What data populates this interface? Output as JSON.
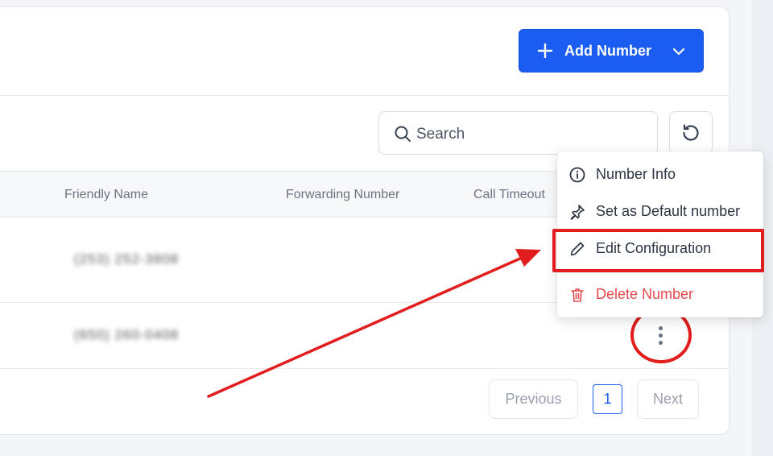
{
  "toolbar": {
    "add_label": "Add Number"
  },
  "search": {
    "placeholder": "Search"
  },
  "table": {
    "headers": [
      "Friendly Name",
      "Forwarding Number",
      "Call Timeout"
    ],
    "rows": [
      {
        "friendly_name": "(253) 252-3808"
      },
      {
        "friendly_name": "(650) 260-0408"
      }
    ]
  },
  "menu": {
    "items": [
      {
        "label": "Number Info",
        "icon": "info-icon"
      },
      {
        "label": "Set as Default number",
        "icon": "pin-icon"
      },
      {
        "label": "Edit Configuration",
        "icon": "pencil-icon"
      },
      {
        "label": "Delete Number",
        "icon": "trash-icon"
      }
    ]
  },
  "pagination": {
    "previous_label": "Previous",
    "current_page": "1",
    "next_label": "Next"
  },
  "colors": {
    "primary": "#1b5cf2",
    "danger": "#e5484d",
    "annotation": "#e11d1d"
  }
}
